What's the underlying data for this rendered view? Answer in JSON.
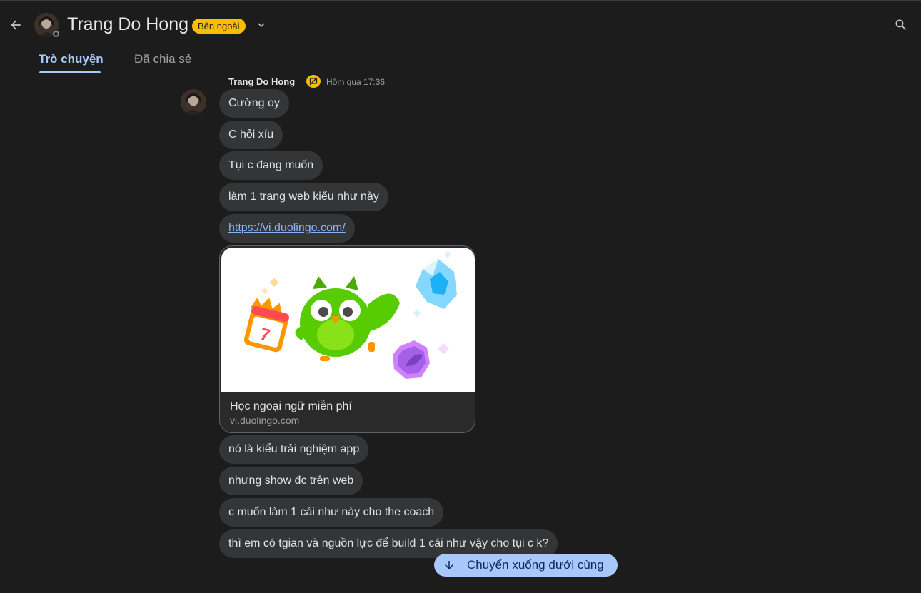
{
  "header": {
    "contact_name": "Trang Do Hong",
    "badge": "Bên ngoài",
    "back_icon": "arrow-back-icon",
    "dropdown_icon": "chevron-down-icon",
    "search_icon": "search-icon"
  },
  "tabs": [
    {
      "label": "Trò chuyện",
      "active": true
    },
    {
      "label": "Đã chia sẻ",
      "active": false
    }
  ],
  "message_group": {
    "sender": "Trang Do Hong",
    "sender_badge_icon": "external-user-icon",
    "time": "Hôm qua 17:36",
    "messages": [
      "Cường oy",
      "C hỏi xíu",
      "Tụi c đang muốn",
      "làm 1 trang web kiểu như này",
      "https://vi.duolingo.com/",
      "nó là kiểu trải nghiệm app",
      "nhưng show đc trên web",
      "c muốn làm 1 cái như này cho the coach",
      "thì em có tgian và nguồn lực để build 1 cái như vậy cho tụi c k?"
    ],
    "link_preview": {
      "title": "Học ngoại ngữ miễn phí",
      "domain": "vi.duolingo.com"
    }
  },
  "scroll_down": {
    "label": "Chuyển xuống dưới cùng",
    "icon": "arrow-down-icon"
  },
  "colors": {
    "background": "#1c1c1c",
    "bubble": "#333537",
    "accent": "#a8c7fa",
    "badge": "#fbbc04",
    "link": "#8ab4f8"
  }
}
